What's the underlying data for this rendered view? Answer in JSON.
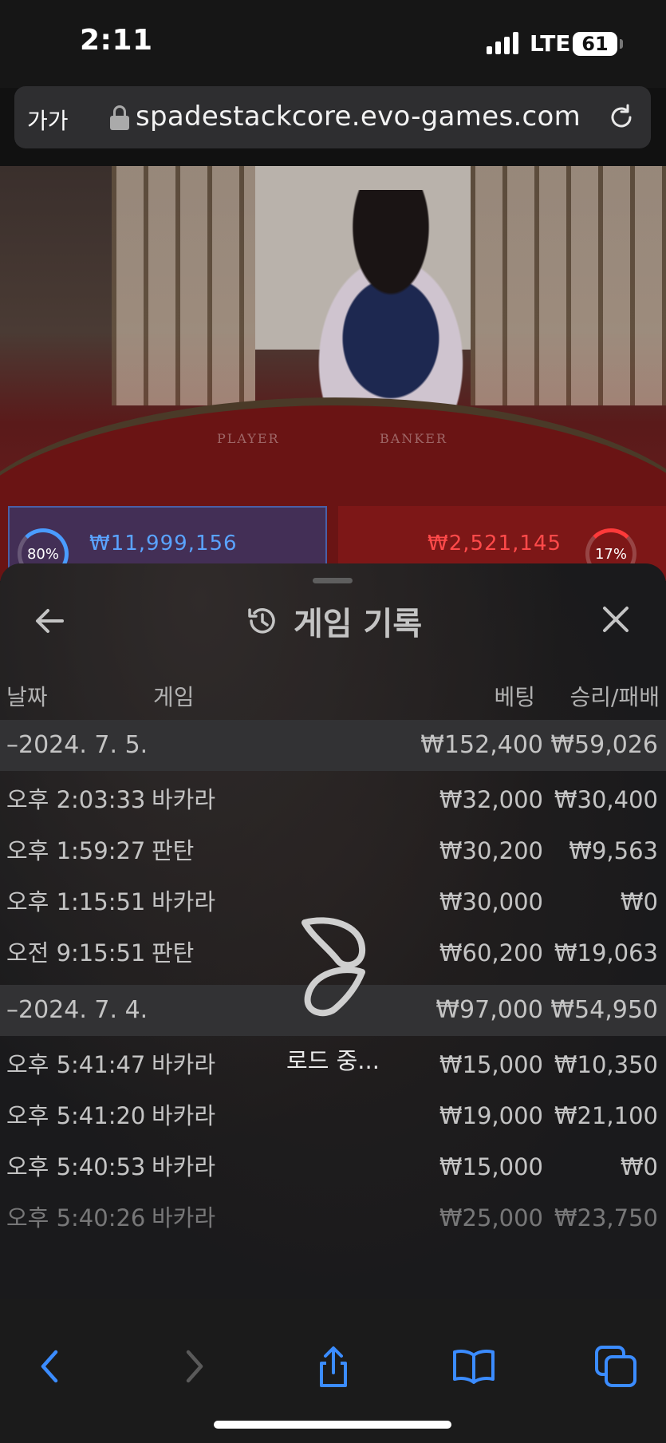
{
  "status_bar": {
    "time": "2:11",
    "network": "LTE",
    "battery": "61"
  },
  "browser": {
    "text_size_button": "가가",
    "url": "spadestackcore.evo-games.com"
  },
  "game_video": {
    "table_labels": {
      "player": "PLAYER",
      "banker": "BANKER"
    },
    "player_stats": {
      "percent": "80%",
      "amount": "₩11,999,156"
    },
    "banker_stats": {
      "percent": "17%",
      "amount": "₩2,521,145"
    },
    "colors": {
      "player": "#5aa3ff",
      "banker": "#ff4a4a"
    }
  },
  "history_panel": {
    "title": "게임 기록",
    "columns": {
      "date": "날짜",
      "game": "게임",
      "bet": "베팅",
      "result": "승리/패배"
    },
    "groups": [
      {
        "date": "–2024. 7. 5.",
        "bet_total": "₩152,400",
        "result_total": "₩59,026",
        "rows": [
          {
            "time": "오후 2:03:33",
            "game": "바카라",
            "bet": "₩32,000",
            "result": "₩30,400"
          },
          {
            "time": "오후 1:59:27",
            "game": "판탄",
            "bet": "₩30,200",
            "result": "₩9,563"
          },
          {
            "time": "오후 1:15:51",
            "game": "바카라",
            "bet": "₩30,000",
            "result": "₩0"
          },
          {
            "time": "오전 9:15:51",
            "game": "판탄",
            "bet": "₩60,200",
            "result": "₩19,063"
          }
        ]
      },
      {
        "date": "–2024. 7. 4.",
        "bet_total": "₩97,000",
        "result_total": "₩54,950",
        "rows": [
          {
            "time": "오후 5:41:47",
            "game": "바카라",
            "bet": "₩15,000",
            "result": "₩10,350"
          },
          {
            "time": "오후 5:41:20",
            "game": "바카라",
            "bet": "₩19,000",
            "result": "₩21,100"
          },
          {
            "time": "오후 5:40:53",
            "game": "바카라",
            "bet": "₩15,000",
            "result": "₩0"
          },
          {
            "time": "오후 5:40:26",
            "game": "바카라",
            "bet": "₩25,000",
            "result": "₩23,750"
          }
        ]
      }
    ],
    "loading_text": "로드 중..."
  },
  "toolbar": {
    "icons": [
      "back-icon",
      "forward-icon",
      "share-icon",
      "bookmarks-icon",
      "tabs-icon"
    ],
    "accent": "#3b8cff"
  }
}
